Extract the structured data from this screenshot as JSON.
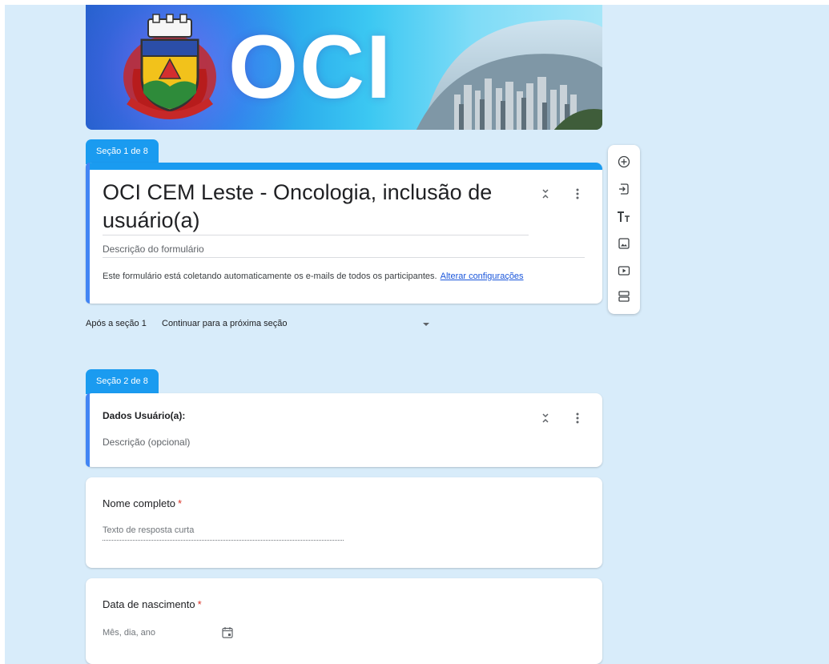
{
  "banner": {
    "title": "OCI"
  },
  "section1": {
    "tab_label": "Seção 1 de 8",
    "form_title": "OCI CEM Leste - Oncologia, inclusão de usuário(a)",
    "description_placeholder": "Descrição do formulário",
    "email_notice": "Este formulário está coletando automaticamente os e-mails de todos os participantes.",
    "email_settings_link": "Alterar configurações"
  },
  "after_section": {
    "label": "Após a seção 1",
    "selected": "Continuar para a próxima seção"
  },
  "section2": {
    "tab_label": "Seção 2 de 8",
    "title": "Dados Usuário(a):",
    "description_placeholder": "Descrição (opcional)"
  },
  "questions": [
    {
      "title": "Nome completo",
      "required_mark": "*",
      "answer_placeholder": "Texto de resposta curta"
    },
    {
      "title": "Data de nascimento",
      "required_mark": "*",
      "answer_placeholder": "Mês, dia, ano"
    }
  ],
  "toolbar": {
    "icons": [
      "add-question-icon",
      "import-questions-icon",
      "add-title-icon",
      "add-image-icon",
      "add-video-icon",
      "add-section-icon"
    ]
  },
  "colors": {
    "page_background": "#d8ecfa",
    "section_accent": "#1a9bf0",
    "card_accent": "#4285f4",
    "required": "#d93025",
    "link": "#1a56db"
  }
}
